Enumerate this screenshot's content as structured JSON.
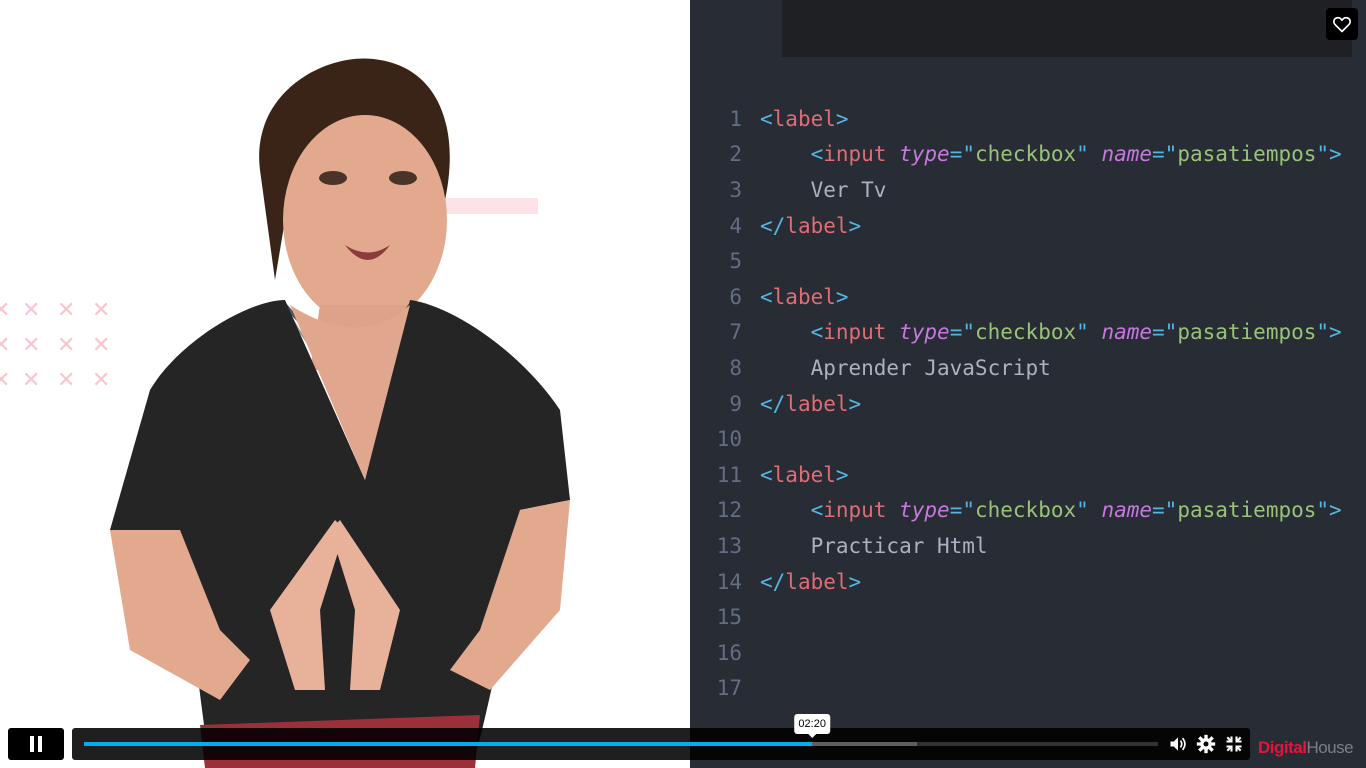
{
  "colors": {
    "editor_bg": "#282c34",
    "progress_played": "#00adef",
    "brand_red": "#e8133a"
  },
  "editor": {
    "lines": [
      {
        "n": "1",
        "tokens": [
          {
            "t": "punct",
            "v": "<"
          },
          {
            "t": "tag",
            "v": "label"
          },
          {
            "t": "punct",
            "v": ">"
          }
        ]
      },
      {
        "n": "2",
        "tokens": [
          {
            "t": "text",
            "v": "    "
          },
          {
            "t": "punct",
            "v": "<"
          },
          {
            "t": "tag",
            "v": "input"
          },
          {
            "t": "text",
            "v": " "
          },
          {
            "t": "attr",
            "v": "type"
          },
          {
            "t": "punct",
            "v": "=\""
          },
          {
            "t": "str",
            "v": "checkbox"
          },
          {
            "t": "punct",
            "v": "\""
          },
          {
            "t": "text",
            "v": " "
          },
          {
            "t": "attr",
            "v": "name"
          },
          {
            "t": "punct",
            "v": "=\""
          },
          {
            "t": "str",
            "v": "pasatiempos"
          },
          {
            "t": "punct",
            "v": "\">"
          }
        ]
      },
      {
        "n": "3",
        "tokens": [
          {
            "t": "text",
            "v": "    Ver Tv"
          }
        ]
      },
      {
        "n": "4",
        "tokens": [
          {
            "t": "punct",
            "v": "</"
          },
          {
            "t": "tag",
            "v": "label"
          },
          {
            "t": "punct",
            "v": ">"
          }
        ]
      },
      {
        "n": "5",
        "tokens": []
      },
      {
        "n": "6",
        "tokens": [
          {
            "t": "punct",
            "v": "<"
          },
          {
            "t": "tag",
            "v": "label"
          },
          {
            "t": "punct",
            "v": ">"
          }
        ]
      },
      {
        "n": "7",
        "tokens": [
          {
            "t": "text",
            "v": "    "
          },
          {
            "t": "punct",
            "v": "<"
          },
          {
            "t": "tag",
            "v": "input"
          },
          {
            "t": "text",
            "v": " "
          },
          {
            "t": "attr",
            "v": "type"
          },
          {
            "t": "punct",
            "v": "=\""
          },
          {
            "t": "str",
            "v": "checkbox"
          },
          {
            "t": "punct",
            "v": "\""
          },
          {
            "t": "text",
            "v": " "
          },
          {
            "t": "attr",
            "v": "name"
          },
          {
            "t": "punct",
            "v": "=\""
          },
          {
            "t": "str",
            "v": "pasatiempos"
          },
          {
            "t": "punct",
            "v": "\">"
          }
        ]
      },
      {
        "n": "8",
        "tokens": [
          {
            "t": "text",
            "v": "    Aprender JavaScript"
          }
        ]
      },
      {
        "n": "9",
        "tokens": [
          {
            "t": "punct",
            "v": "</"
          },
          {
            "t": "tag",
            "v": "label"
          },
          {
            "t": "punct",
            "v": ">"
          }
        ]
      },
      {
        "n": "10",
        "tokens": []
      },
      {
        "n": "11",
        "tokens": [
          {
            "t": "punct",
            "v": "<"
          },
          {
            "t": "tag",
            "v": "label"
          },
          {
            "t": "punct",
            "v": ">"
          }
        ]
      },
      {
        "n": "12",
        "tokens": [
          {
            "t": "text",
            "v": "    "
          },
          {
            "t": "punct",
            "v": "<"
          },
          {
            "t": "tag",
            "v": "input"
          },
          {
            "t": "text",
            "v": " "
          },
          {
            "t": "attr",
            "v": "type"
          },
          {
            "t": "punct",
            "v": "=\""
          },
          {
            "t": "str",
            "v": "checkbox"
          },
          {
            "t": "punct",
            "v": "\""
          },
          {
            "t": "text",
            "v": " "
          },
          {
            "t": "attr",
            "v": "name"
          },
          {
            "t": "punct",
            "v": "=\""
          },
          {
            "t": "str",
            "v": "pasatiempos"
          },
          {
            "t": "punct",
            "v": "\">"
          }
        ]
      },
      {
        "n": "13",
        "tokens": [
          {
            "t": "text",
            "v": "    Practicar Html"
          }
        ]
      },
      {
        "n": "14",
        "tokens": [
          {
            "t": "punct",
            "v": "</"
          },
          {
            "t": "tag",
            "v": "label"
          },
          {
            "t": "punct",
            "v": ">"
          }
        ]
      },
      {
        "n": "15",
        "tokens": []
      },
      {
        "n": "16",
        "tokens": []
      },
      {
        "n": "17",
        "tokens": []
      }
    ]
  },
  "player": {
    "current_time": "02:20",
    "played_fraction": 0.678,
    "buffered_fraction": 0.776,
    "play_icon": "pause-icon",
    "volume_icon": "volume-icon",
    "settings_icon": "gear-icon",
    "fullscreen_icon": "exit-fullscreen-icon",
    "favorite_icon": "heart-icon"
  },
  "brand": {
    "part1": "Digital",
    "part2": "House"
  }
}
